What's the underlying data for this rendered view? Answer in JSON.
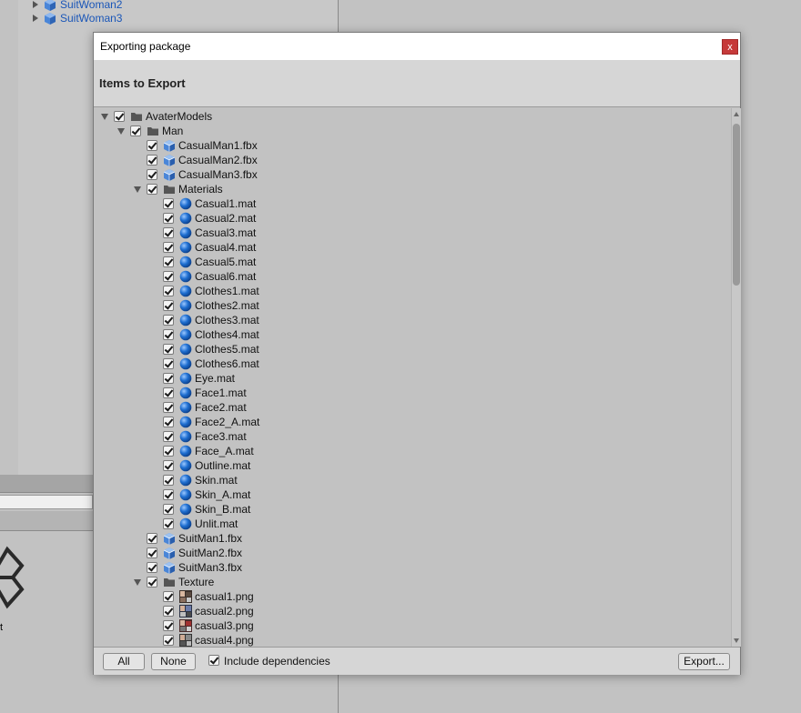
{
  "background": {
    "hierarchy_items": [
      "SuitWoman2",
      "SuitWoman3"
    ],
    "partial_text": "t"
  },
  "dialog": {
    "title": "Exporting package",
    "close_label": "x",
    "heading": "Items to Export",
    "tree": [
      {
        "label": "AvaterModels",
        "type": "folder",
        "depth": 0,
        "expanded": true
      },
      {
        "label": "Man",
        "type": "folder",
        "depth": 1,
        "expanded": true
      },
      {
        "label": "CasualMan1.fbx",
        "type": "model",
        "depth": 2
      },
      {
        "label": "CasualMan2.fbx",
        "type": "model",
        "depth": 2
      },
      {
        "label": "CasualMan3.fbx",
        "type": "model",
        "depth": 2
      },
      {
        "label": "Materials",
        "type": "folder",
        "depth": 2,
        "expanded": true
      },
      {
        "label": "Casual1.mat",
        "type": "material",
        "depth": 3
      },
      {
        "label": "Casual2.mat",
        "type": "material",
        "depth": 3
      },
      {
        "label": "Casual3.mat",
        "type": "material",
        "depth": 3
      },
      {
        "label": "Casual4.mat",
        "type": "material",
        "depth": 3
      },
      {
        "label": "Casual5.mat",
        "type": "material",
        "depth": 3
      },
      {
        "label": "Casual6.mat",
        "type": "material",
        "depth": 3
      },
      {
        "label": "Clothes1.mat",
        "type": "material",
        "depth": 3
      },
      {
        "label": "Clothes2.mat",
        "type": "material",
        "depth": 3
      },
      {
        "label": "Clothes3.mat",
        "type": "material",
        "depth": 3
      },
      {
        "label": "Clothes4.mat",
        "type": "material",
        "depth": 3
      },
      {
        "label": "Clothes5.mat",
        "type": "material",
        "depth": 3
      },
      {
        "label": "Clothes6.mat",
        "type": "material",
        "depth": 3
      },
      {
        "label": "Eye.mat",
        "type": "material",
        "depth": 3
      },
      {
        "label": "Face1.mat",
        "type": "material",
        "depth": 3
      },
      {
        "label": "Face2.mat",
        "type": "material",
        "depth": 3
      },
      {
        "label": "Face2_A.mat",
        "type": "material",
        "depth": 3
      },
      {
        "label": "Face3.mat",
        "type": "material",
        "depth": 3
      },
      {
        "label": "Face_A.mat",
        "type": "material",
        "depth": 3
      },
      {
        "label": "Outline.mat",
        "type": "material",
        "depth": 3
      },
      {
        "label": "Skin.mat",
        "type": "material",
        "depth": 3
      },
      {
        "label": "Skin_A.mat",
        "type": "material",
        "depth": 3
      },
      {
        "label": "Skin_B.mat",
        "type": "material",
        "depth": 3
      },
      {
        "label": "Unlit.mat",
        "type": "material",
        "depth": 3
      },
      {
        "label": "SuitMan1.fbx",
        "type": "model",
        "depth": 2
      },
      {
        "label": "SuitMan2.fbx",
        "type": "model",
        "depth": 2
      },
      {
        "label": "SuitMan3.fbx",
        "type": "model",
        "depth": 2
      },
      {
        "label": "Texture",
        "type": "folder",
        "depth": 2,
        "expanded": true
      },
      {
        "label": "casual1.png",
        "type": "texture",
        "depth": 3
      },
      {
        "label": "casual2.png",
        "type": "texture",
        "depth": 3
      },
      {
        "label": "casual3.png",
        "type": "texture",
        "depth": 3
      },
      {
        "label": "casual4.png",
        "type": "texture",
        "depth": 3
      }
    ],
    "footer": {
      "all_label": "All",
      "none_label": "None",
      "include_dependencies_label": "Include dependencies",
      "include_dependencies_checked": true,
      "export_label": "Export..."
    }
  },
  "colors": {
    "close_button": "#c63a3a",
    "material_blue": "#1f6fd1",
    "folder_gray": "#555555",
    "model_blue": "#4a86d8"
  }
}
